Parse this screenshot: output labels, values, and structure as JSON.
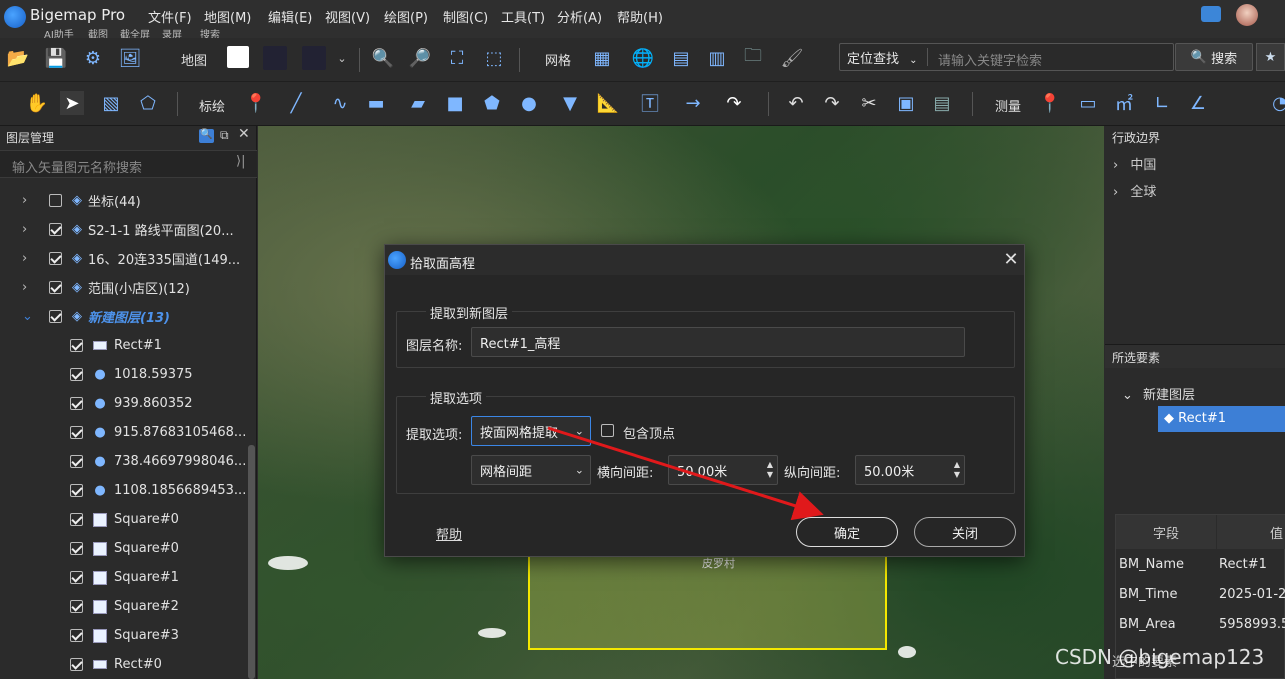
{
  "app": {
    "name": "Bigemap Pro"
  },
  "quick_actions": [
    "AI助手",
    "截图",
    "截全屏",
    "录屏",
    "搜索"
  ],
  "menu": [
    "文件(F)",
    "地图(M)",
    "编辑(E)",
    "视图(V)",
    "绘图(P)",
    "制图(C)",
    "工具(T)",
    "分析(A)",
    "帮助(H)"
  ],
  "toolbar1": {
    "map_label": "地图",
    "grid_label": "网格"
  },
  "search": {
    "mode": "定位查找",
    "placeholder": "请输入关键字检索",
    "button": "搜索"
  },
  "toolbar2": {
    "annotate_label": "标绘",
    "measure_label": "测量"
  },
  "layer_panel": {
    "title": "图层管理",
    "search_placeholder": "输入矢量图元名称搜索",
    "layers": [
      {
        "label": "坐标(44)",
        "checked": false,
        "expanded": false
      },
      {
        "label": "S2-1-1 路线平面图(20...",
        "checked": true,
        "expanded": false
      },
      {
        "label": "16、20连335国道(149...",
        "checked": true,
        "expanded": false
      },
      {
        "label": "范围(小店区)(12)",
        "checked": true,
        "expanded": false
      },
      {
        "label": "新建图层(13)",
        "checked": true,
        "expanded": true
      }
    ],
    "children": [
      {
        "label": "Rect#1",
        "icon": "rect-icon"
      },
      {
        "label": "1018.59375",
        "icon": "pin-icon"
      },
      {
        "label": "939.860352",
        "icon": "pin-icon"
      },
      {
        "label": "915.87683105468...",
        "icon": "pin-icon"
      },
      {
        "label": "738.46697998046...",
        "icon": "pin-icon"
      },
      {
        "label": "1108.1856689453...",
        "icon": "pin-icon"
      },
      {
        "label": "Square#0",
        "icon": "square-icon"
      },
      {
        "label": "Square#0",
        "icon": "square-icon"
      },
      {
        "label": "Square#1",
        "icon": "square-icon"
      },
      {
        "label": "Square#2",
        "icon": "square-icon"
      },
      {
        "label": "Square#3",
        "icon": "square-icon"
      },
      {
        "label": "Rect#0",
        "icon": "rect-icon"
      }
    ]
  },
  "map": {
    "village": "皮罗村"
  },
  "right_panel": {
    "admin_title": "行政边界",
    "admin_items": [
      "中国",
      "全球"
    ],
    "selected_title": "所选要素",
    "selected_layer": "新建图层",
    "selected_item": "Rect#1",
    "table_headers": [
      "字段",
      "值"
    ],
    "fields": [
      {
        "name": "BM_Name",
        "value": "Rect#1"
      },
      {
        "name": "BM_Time",
        "value": "2025-01-2"
      },
      {
        "name": "BM_Area",
        "value": "5958993.5"
      }
    ],
    "footer": "选中的要素"
  },
  "dialog": {
    "title": "拾取面高程",
    "group1_title": "提取到新图层",
    "layer_name_label": "图层名称:",
    "layer_name_value": "Rect#1_高程",
    "group2_title": "提取选项",
    "extract_label": "提取选项:",
    "extract_value": "按面网格提取",
    "include_vertex_label": "包含顶点",
    "include_vertex_checked": false,
    "grid_mode_value": "网格间距",
    "h_spacing_label": "横向间距:",
    "h_spacing_value": "50.00米",
    "v_spacing_label": "纵向间距:",
    "v_spacing_value": "50.00米",
    "help_label": "帮助",
    "ok_label": "确定",
    "close_label": "关闭"
  },
  "watermark": "CSDN @bigemap123",
  "colors": {
    "accent": "#3d7fd6",
    "arrow": "#e0191b",
    "aoi_border": "#f4e800"
  }
}
